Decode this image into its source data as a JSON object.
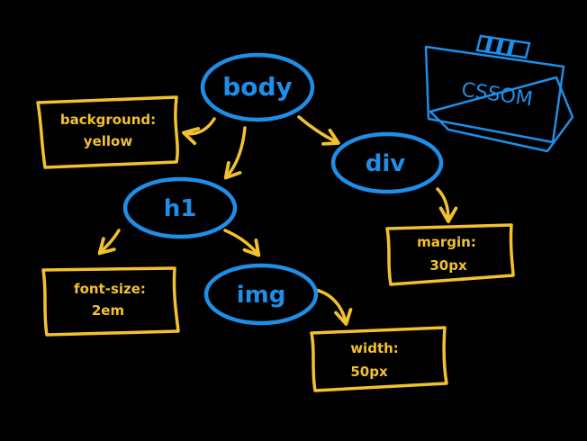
{
  "diagram": {
    "badge": {
      "label": "CSSOM"
    },
    "nodes": {
      "body": "body",
      "div": "div",
      "h1": "h1",
      "img": "img"
    },
    "props": {
      "background": [
        "background:",
        "yellow"
      ],
      "margin": [
        "margin:",
        "30px"
      ],
      "font_size": [
        "font-size:",
        "2em"
      ],
      "width": [
        "width:",
        "50px"
      ]
    },
    "colors": {
      "background": "#000000",
      "node": "#1e8ee8",
      "property": "#f2c12e"
    }
  }
}
